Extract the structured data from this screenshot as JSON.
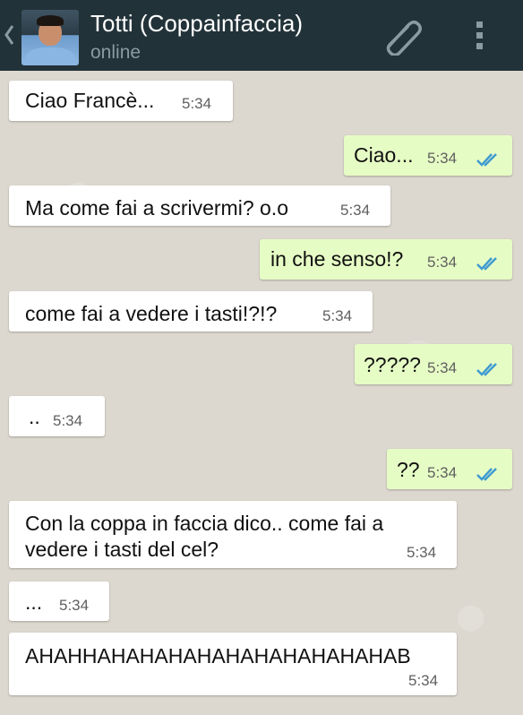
{
  "header": {
    "contact_name": "Totti (Coppainfaccia)",
    "status": "online",
    "background_color": "#223239",
    "icons": [
      "back-chevron-icon",
      "contact-avatar",
      "paperclip-icon",
      "overflow-menu-icon"
    ]
  },
  "messages": [
    {
      "direction": "incoming",
      "text": "Ciao Francè...",
      "time": "5:34"
    },
    {
      "direction": "outgoing",
      "text": "Ciao...",
      "time": "5:34",
      "status": "read"
    },
    {
      "direction": "incoming",
      "text": "Ma come fai a scrivermi? o.o",
      "time": "5:34"
    },
    {
      "direction": "outgoing",
      "text": "in che senso!?",
      "time": "5:34",
      "status": "read"
    },
    {
      "direction": "incoming",
      "text": "come fai a vedere i tasti!?!?",
      "time": "5:34"
    },
    {
      "direction": "outgoing",
      "text": "?????",
      "time": "5:34",
      "status": "read"
    },
    {
      "direction": "incoming",
      "text": "..",
      "time": "5:34"
    },
    {
      "direction": "outgoing",
      "text": "??",
      "time": "5:34",
      "status": "read"
    },
    {
      "direction": "incoming",
      "text_line1": "Con la coppa in faccia dico.. come fai a",
      "text_line2": "vedere i tasti del cel?",
      "time": "5:34"
    },
    {
      "direction": "incoming",
      "text": "...",
      "time": "5:34"
    },
    {
      "direction": "incoming",
      "text": "AHAHHAHAHAHAHAHAHAHAHAHAHAB",
      "time": "5:34"
    }
  ],
  "colors": {
    "incoming_bubble": "#ffffff",
    "outgoing_bubble": "#e6fcc5",
    "read_tick": "#3e9bd1",
    "chat_background": "#dcd8cf"
  }
}
